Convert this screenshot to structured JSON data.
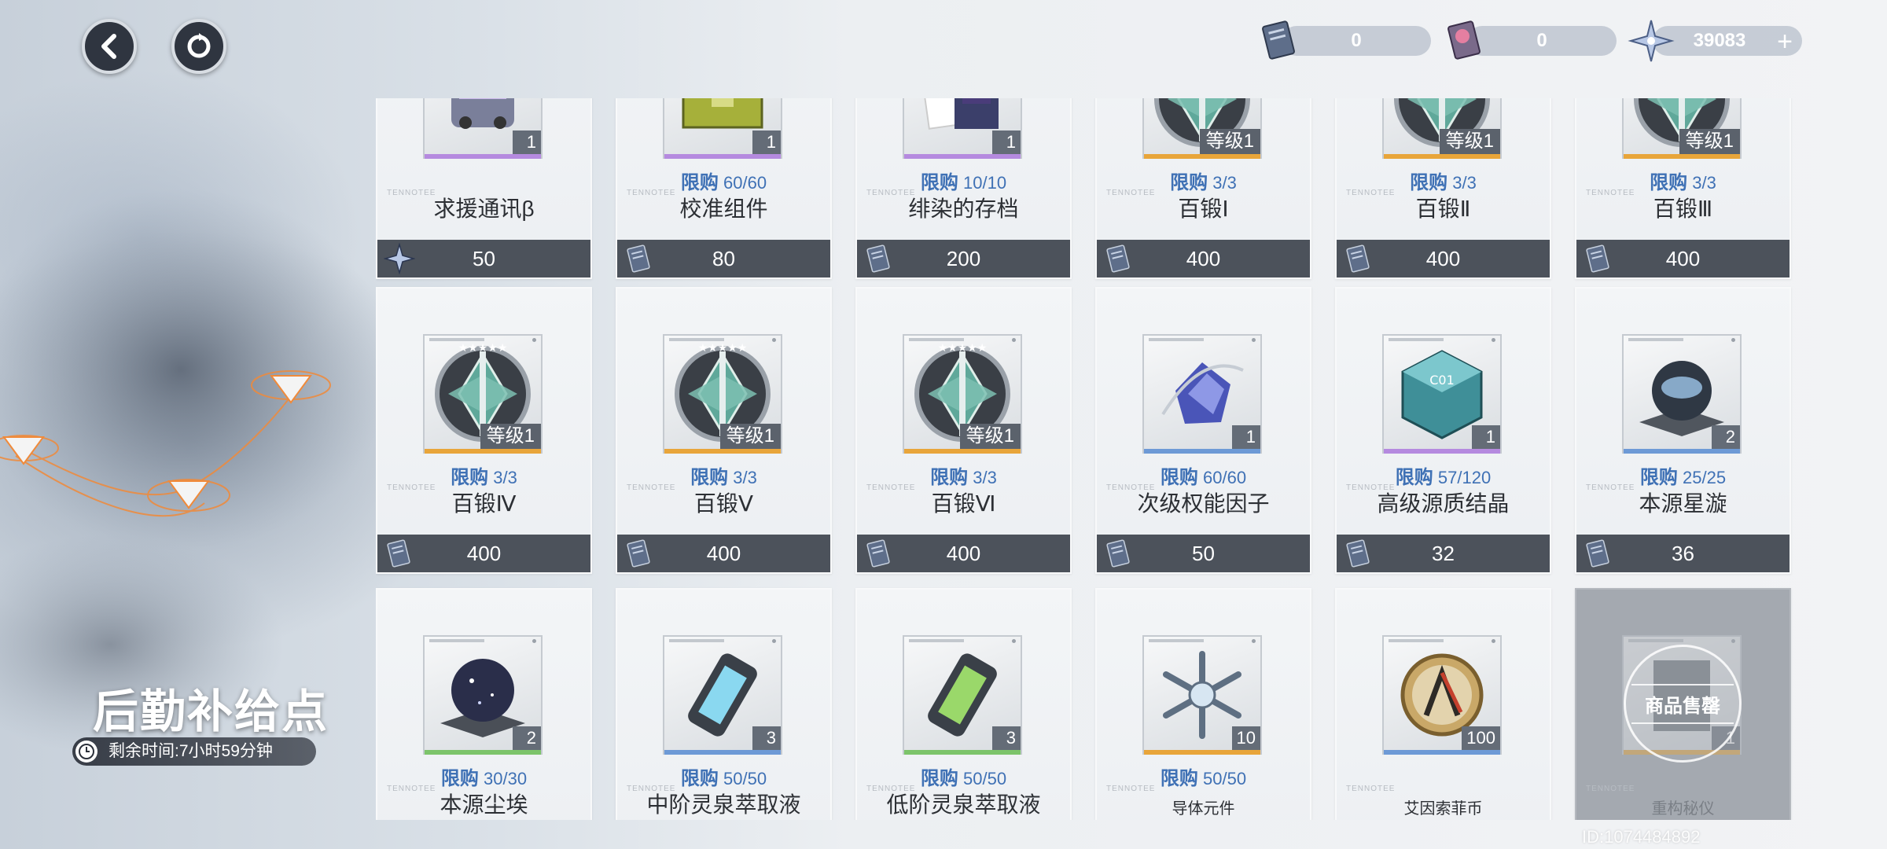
{
  "header": {
    "back_icon": "chevron-left-icon",
    "refresh_icon": "refresh-icon",
    "currencies": [
      {
        "icon": "ticket-card-icon",
        "value": "0"
      },
      {
        "icon": "pink-card-icon",
        "value": "0"
      },
      {
        "icon": "star-shard-icon",
        "value": "39083",
        "plus": "+"
      }
    ]
  },
  "shop": {
    "title": "后勤补给点",
    "timer": "剩余时间:7小时59分钟",
    "uid": "ID:1074484892",
    "brand": "TENNOTEE"
  },
  "items": [
    {
      "name": "求援通讯β",
      "limit": "",
      "qty": "1",
      "level": "",
      "price": "50",
      "price_icon": "star-shard-icon",
      "rarity": "#b58adf",
      "icon": "car-icon"
    },
    {
      "name": "校准组件",
      "limit_label": "限购",
      "limit": "60/60",
      "qty": "1",
      "level": "",
      "price": "80",
      "price_icon": "ticket-card-icon",
      "rarity": "#b58adf",
      "icon": "toolbox-icon"
    },
    {
      "name": "绯染的存档",
      "limit_label": "限购",
      "limit": "10/10",
      "qty": "1",
      "level": "",
      "price": "200",
      "price_icon": "ticket-card-icon",
      "rarity": "#b58adf",
      "icon": "photo-card-icon"
    },
    {
      "name": "百锻Ⅰ",
      "limit_label": "限购",
      "limit": "3/3",
      "qty": "",
      "level": "等级1",
      "price": "400",
      "price_icon": "ticket-card-icon",
      "rarity": "#e8a53a",
      "icon": "emblem-icon"
    },
    {
      "name": "百锻Ⅱ",
      "limit_label": "限购",
      "limit": "3/3",
      "qty": "",
      "level": "等级1",
      "price": "400",
      "price_icon": "ticket-card-icon",
      "rarity": "#e8a53a",
      "icon": "emblem-icon"
    },
    {
      "name": "百锻Ⅲ",
      "limit_label": "限购",
      "limit": "3/3",
      "qty": "",
      "level": "等级1",
      "price": "400",
      "price_icon": "ticket-card-icon",
      "rarity": "#e8a53a",
      "icon": "emblem-icon"
    },
    {
      "name": "百锻Ⅳ",
      "limit_label": "限购",
      "limit": "3/3",
      "qty": "",
      "level": "等级1",
      "price": "400",
      "price_icon": "ticket-card-icon",
      "rarity": "#e8a53a",
      "icon": "emblem-icon"
    },
    {
      "name": "百锻Ⅴ",
      "limit_label": "限购",
      "limit": "3/3",
      "qty": "",
      "level": "等级1",
      "price": "400",
      "price_icon": "ticket-card-icon",
      "rarity": "#e8a53a",
      "icon": "emblem-icon"
    },
    {
      "name": "百锻Ⅵ",
      "limit_label": "限购",
      "limit": "3/3",
      "qty": "",
      "level": "等级1",
      "price": "400",
      "price_icon": "ticket-card-icon",
      "rarity": "#e8a53a",
      "icon": "emblem-icon"
    },
    {
      "name": "次级权能因子",
      "limit_label": "限购",
      "limit": "60/60",
      "qty": "1",
      "level": "",
      "price": "50",
      "price_icon": "ticket-card-icon",
      "rarity": "#6d9ad6",
      "icon": "crystal-cluster-icon"
    },
    {
      "name": "高级源质结晶",
      "limit_label": "限购",
      "limit": "57/120",
      "qty": "1",
      "level": "",
      "price": "32",
      "price_icon": "ticket-card-icon",
      "rarity": "#b58adf",
      "icon": "cube-crystal-icon"
    },
    {
      "name": "本源星漩",
      "limit_label": "限购",
      "limit": "25/25",
      "qty": "2",
      "level": "",
      "price": "36",
      "price_icon": "ticket-card-icon",
      "rarity": "#6d9ad6",
      "icon": "orb-icon"
    },
    {
      "name": "本源尘埃",
      "limit_label": "限购",
      "limit": "30/30",
      "qty": "2",
      "level": "",
      "price": "",
      "price_icon": "",
      "rarity": "#7cc46a",
      "icon": "dark-orb-icon"
    },
    {
      "name": "中阶灵泉萃取液",
      "limit_label": "限购",
      "limit": "50/50",
      "qty": "3",
      "level": "",
      "price": "",
      "price_icon": "",
      "rarity": "#6d9ad6",
      "icon": "blue-canister-icon"
    },
    {
      "name": "低阶灵泉萃取液",
      "limit_label": "限购",
      "limit": "50/50",
      "qty": "3",
      "level": "",
      "price": "",
      "price_icon": "",
      "rarity": "#7cc46a",
      "icon": "green-canister-icon"
    },
    {
      "name": "导体元件",
      "limit_label": "限购",
      "limit": "50/50",
      "qty": "10",
      "level": "",
      "price": "",
      "price_icon": "",
      "rarity": "#e8a53a",
      "icon": "snowflake-icon",
      "small": true
    },
    {
      "name": "艾因索菲币",
      "limit_label": "",
      "limit": "",
      "qty": "100",
      "level": "",
      "price": "",
      "price_icon": "",
      "rarity": "#6d9ad6",
      "icon": "coin-icon",
      "small": true
    },
    {
      "name": "重构秘仪",
      "limit_label": "",
      "limit": "",
      "qty": "1",
      "level": "",
      "price": "",
      "price_icon": "",
      "rarity": "#e8a53a",
      "icon": "ritual-icon",
      "small": true,
      "soldout": "商品售罄"
    }
  ],
  "colors": {
    "accent": "#3f71b5",
    "price_bar": "#4c525b"
  }
}
